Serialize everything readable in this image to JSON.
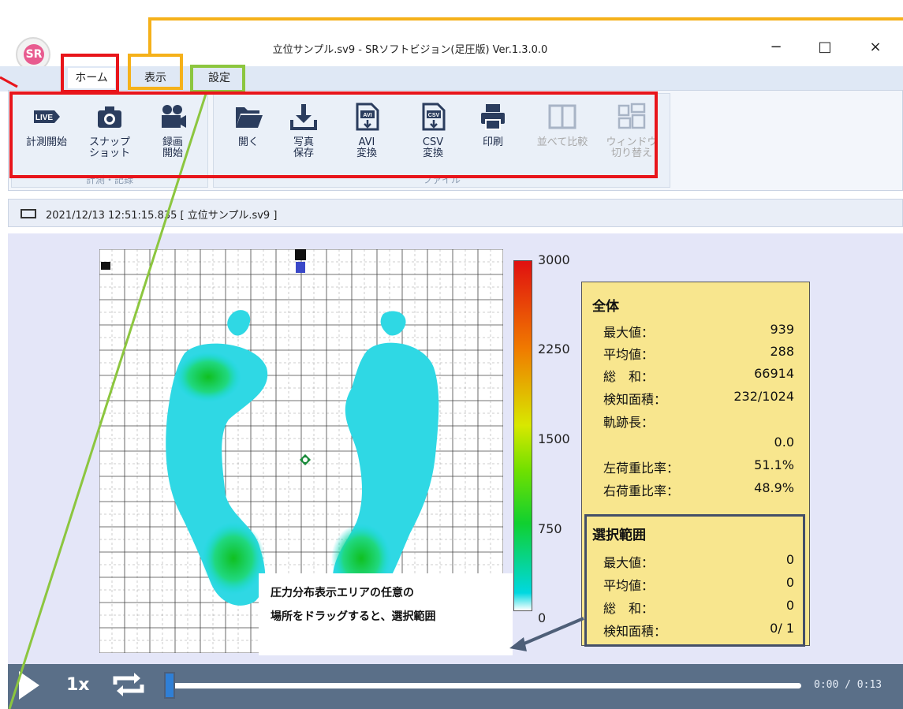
{
  "window": {
    "title": "立位サンプル.sv9 - SRソフトビジョン(足圧版) Ver.1.3.0.0",
    "minimize_glyph": "−",
    "maximize_glyph": "□",
    "close_glyph": "×",
    "logo_icon": "sr-logo-icon"
  },
  "tabs": [
    {
      "label": "ホーム"
    },
    {
      "label": "表示"
    },
    {
      "label": "設定"
    }
  ],
  "ribbon": {
    "group1_label": "計測・記録",
    "group2_label": "ファイル",
    "buttons": [
      {
        "label": "計測開始",
        "icon": "live-icon"
      },
      {
        "label": "スナップ\nショット",
        "icon": "camera-icon"
      },
      {
        "label": "録画\n開始",
        "icon": "video-camera-icon"
      },
      {
        "label": "開く",
        "icon": "folder-icon"
      },
      {
        "label": "写真\n保存",
        "icon": "download-icon"
      },
      {
        "label": "AVI\n変換",
        "icon": "avi-file-icon"
      },
      {
        "label": "CSV\n変換",
        "icon": "csv-file-icon"
      },
      {
        "label": "印刷",
        "icon": "printer-icon"
      },
      {
        "label": "並べて比較",
        "icon": "compare-icon"
      },
      {
        "label": "ウィンドウ\n切り替え",
        "icon": "window-switch-icon"
      }
    ]
  },
  "status": {
    "text": "2021/12/13 12:51:15.835  [ 立位サンプル.sv9 ]"
  },
  "colorbar": {
    "max": "3000",
    "t1": "2250",
    "t2": "1500",
    "t3": "750",
    "min": "0"
  },
  "panel": {
    "overall_header": "全体",
    "rows": [
      {
        "label": "最大値：",
        "value": "939"
      },
      {
        "label": "平均値：",
        "value": "288"
      },
      {
        "label": "総　和：",
        "value": "66914"
      },
      {
        "label": "検知面積：",
        "value": "232/1024"
      },
      {
        "label": "軌跡長：",
        "value": ""
      },
      {
        "label": "",
        "value": "0.0"
      },
      {
        "label": "左荷重比率：",
        "value": "51.1%"
      },
      {
        "label": "右荷重比率：",
        "value": "48.9%"
      }
    ],
    "selection_header": "選択範囲",
    "sel_rows": [
      {
        "label": "最大値：",
        "value": "0"
      },
      {
        "label": "平均値：",
        "value": "0"
      },
      {
        "label": "総　和：",
        "value": "0"
      },
      {
        "label": "検知面積：",
        "value": "0/ 1"
      }
    ]
  },
  "callout": {
    "line1": "圧力分布表示エリアの任意の",
    "line2": "場所をドラッグすると、選択範囲"
  },
  "player": {
    "speed": "1x",
    "time": "0:00 / 0:13",
    "progress": 0.0
  },
  "colors": {
    "highlight_red": "#e8151b",
    "highlight_orange": "#f5b11a",
    "highlight_green": "#8cc63f",
    "panel_bg": "#f8e68e"
  }
}
